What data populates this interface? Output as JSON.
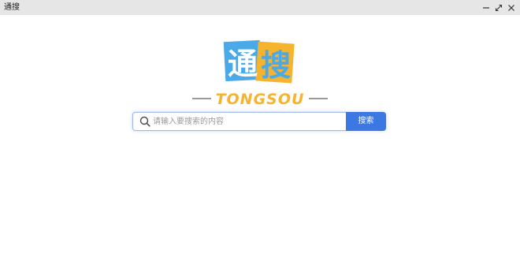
{
  "window": {
    "title": "通搜",
    "controls": {
      "minimize_icon": "minimize-icon",
      "restore_icon": "restore-icon",
      "close_icon": "close-icon"
    }
  },
  "logo": {
    "chinese_char_1": "通",
    "chinese_char_2": "搜",
    "wordmark": "TONGSOU",
    "colors": {
      "blue": "#4aa9e8",
      "orange": "#f6b32e",
      "divider": "#9a9a9a"
    }
  },
  "search": {
    "placeholder": "请输入要搜索的内容",
    "value": "",
    "button_label": "搜索",
    "icon": "search-icon",
    "accent_color": "#3b78e2"
  }
}
